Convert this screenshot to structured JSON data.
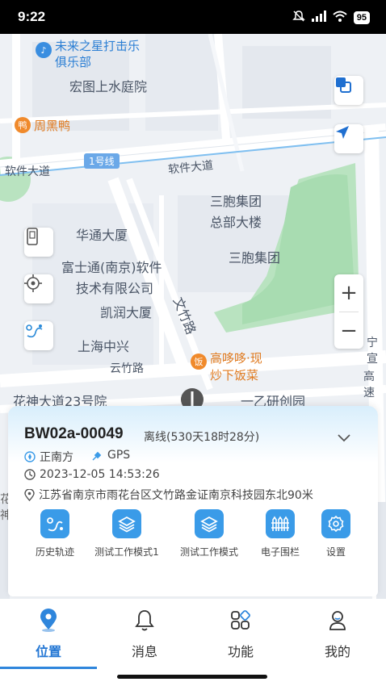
{
  "status": {
    "time": "9:22",
    "battery": "95"
  },
  "map": {
    "labels": {
      "club": "未来之星打击乐",
      "club2": "俱乐部",
      "hongtu": "宏图上水庭院",
      "zhouheiya": "周黑鸭",
      "metro": "1号线",
      "road_left": "软件大道",
      "road_mid": "软件大道",
      "sanbao1": "三胞集团",
      "sanbao1b": "总部大楼",
      "sanbao2": "三胞集团",
      "huatong": "华通大厦",
      "fushitong": "富士通(南京)软件",
      "fushitong2": "技术有限公司",
      "kairun": "凯润大厦",
      "wenzhu": "文竹路",
      "shanghai": "上海中兴",
      "yunzhu": "云竹路",
      "gaoduoduo": "高哆哆·现",
      "gaoduoduo2": "炒下饭菜",
      "huashen": "花神大道23号院",
      "yiyi": "一乙研创园",
      "ningxuan": "宁",
      "ningxuan2": "宣",
      "ningxuan3": "高",
      "ningxuan4": "速",
      "hua": "花",
      "shen": "神"
    },
    "zoom_in": "+",
    "zoom_out": "−"
  },
  "device": {
    "name": "BW02a-00049",
    "status": "离线(530天18时28分)",
    "direction": "正南方",
    "gps": "GPS",
    "time": "2023-12-05 14:53:26",
    "address": "江苏省南京市雨花台区文竹路金证南京科技园东北90米"
  },
  "actions": [
    {
      "label": "历史轨迹"
    },
    {
      "label": "测试工作模式1"
    },
    {
      "label": "测试工作模式"
    },
    {
      "label": "电子围栏"
    },
    {
      "label": "设置"
    }
  ],
  "tabs": [
    {
      "label": "位置"
    },
    {
      "label": "消息"
    },
    {
      "label": "功能"
    },
    {
      "label": "我的"
    }
  ],
  "colors": {
    "accent": "#2477d4",
    "action_bg": "#3a9be8",
    "park": "#b9e3c0"
  }
}
